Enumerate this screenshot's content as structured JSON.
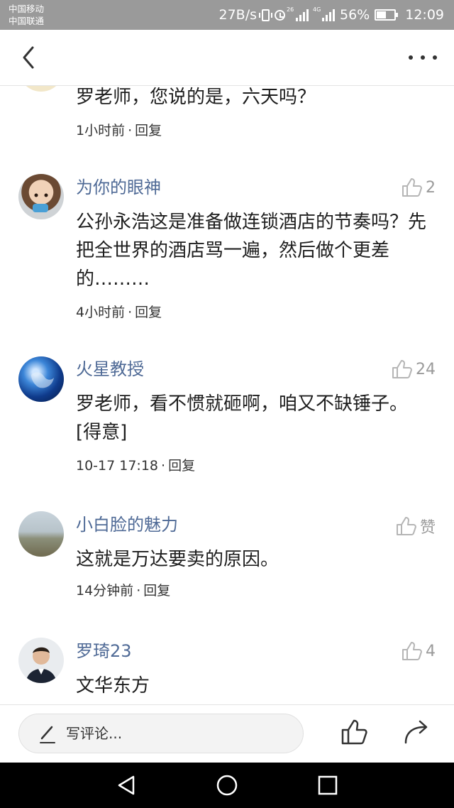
{
  "status_bar": {
    "carrier1": "中国移动",
    "carrier2": "中国联通",
    "net_speed": "27B/s",
    "sig1_tag": "26",
    "sig2_tag": "4G",
    "battery_text": "56%",
    "battery_level": 0.56,
    "time": "12:09"
  },
  "comments": [
    {
      "text": "罗老师，您说的是，六天吗？",
      "time": "1小时前",
      "reply": "回复"
    },
    {
      "username": "为你的眼神",
      "likes": "2",
      "text": "公孙永浩这是准备做连锁酒店的节奏吗？先把全世界的酒店骂一遍，然后做个更差的………",
      "time": "4小时前",
      "reply": "回复"
    },
    {
      "username": "火星教授",
      "likes": "24",
      "text": "罗老师，看不惯就砸啊，咱又不缺锤子。[得意]",
      "time": "10-17 17:18",
      "reply": "回复"
    },
    {
      "username": "小白脸的魅力",
      "likes": "赞",
      "text": "这就是万达要卖的原因。",
      "time": "14分钟前",
      "reply": "回复"
    },
    {
      "username": "罗琦23",
      "likes": "4",
      "text": "文华东方"
    }
  ],
  "bottom_bar": {
    "placeholder": "写评论..."
  },
  "icons": {
    "back": "chevron-left-icon",
    "more": "more-dots-icon",
    "like": "thumbs-up-icon",
    "pen": "pen-icon",
    "share": "share-arrow-icon"
  },
  "colors": {
    "username": "#4f6a96",
    "status_bar": "#9a9a9a",
    "android_nav": "#000000"
  }
}
